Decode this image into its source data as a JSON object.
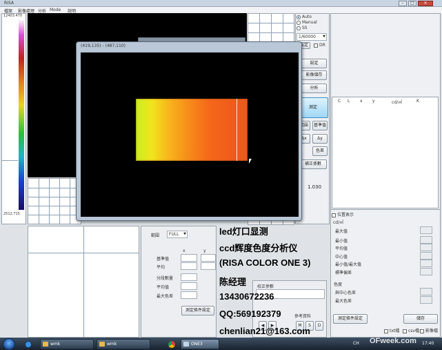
{
  "app": {
    "title": "RISA",
    "menu": [
      "檔案",
      "影像處理",
      "分析",
      "Mode",
      "說明"
    ]
  },
  "scale": {
    "max": "12403.470",
    "min": "2512.715"
  },
  "float_window": {
    "title": "(419,135) - (487,110)"
  },
  "controls": {
    "radio_auto": "Auto",
    "radio_manual": "Manual",
    "radio_ss": "SS",
    "exposure_value": "1/60000",
    "exposure_btn": "設定",
    "dr_label": "DR",
    "btn_set": "設定",
    "btn_image_save": "影像儲存",
    "btn_analyze": "分析",
    "btn_measure": "測定",
    "btn_range": "範圍",
    "btn_standard": "基準值",
    "btn_dx": "Δx",
    "btn_dy": "Δy",
    "btn_color": "色差",
    "btn_correction": "補正係數",
    "value": "1.030"
  },
  "table": {
    "headers": [
      "C",
      "L",
      "x",
      "y",
      "cd/㎡",
      "K"
    ]
  },
  "stats": {
    "checkbox_label": "位置表示",
    "unit": "cd/㎡",
    "rows": [
      "最大值",
      "最小值",
      "平均值",
      "中心值",
      "最小值/最大值",
      "標準偏差"
    ],
    "color_section": "色度",
    "color_rows": [
      "與中心色差",
      "最大色差"
    ],
    "bottom_btn": "測定條件設定",
    "output_btn": "儲存",
    "bottom_checks": [
      "txt檔",
      "csv檔",
      "影像檔"
    ]
  },
  "mid_panel": {
    "range_label": "範圍",
    "range_value": "FULL",
    "col_x": "x",
    "col_y": "y",
    "rows": [
      "基準值",
      "平均",
      "分段數量",
      "平均值",
      "最大色差"
    ],
    "set_btn": "測定條件設定"
  },
  "small_panel": {
    "title": "校正參數",
    "sub": "參考資料",
    "buttons": [
      "◀",
      "▶",
      "M",
      "S",
      "D"
    ]
  },
  "overlay_text": [
    "led灯口显测",
    "ccd辉度色度分析仪",
    "(RISA COLOR ONE 3)",
    "陈经理",
    "13430672236",
    "QQ:569192379",
    "chenlian21@163.com"
  ],
  "taskbar": {
    "buttons": [
      "wmk",
      "wmk",
      "ONE3"
    ],
    "lang": "CH",
    "time": "17:40",
    "watermark": "OFweek.com"
  }
}
